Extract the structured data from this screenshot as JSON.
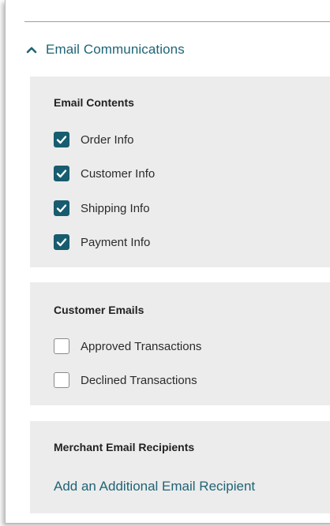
{
  "section": {
    "title": "Email Communications",
    "expanded": true,
    "accent_color": "#1f6475"
  },
  "email_contents": {
    "title": "Email Contents",
    "options": [
      {
        "label": "Order Info",
        "checked": true
      },
      {
        "label": "Customer Info",
        "checked": true
      },
      {
        "label": "Shipping Info",
        "checked": true
      },
      {
        "label": "Payment Info",
        "checked": true
      }
    ]
  },
  "customer_emails": {
    "title": "Customer Emails",
    "options": [
      {
        "label": "Approved Transactions",
        "checked": false
      },
      {
        "label": "Declined Transactions",
        "checked": false
      }
    ]
  },
  "merchant_recipients": {
    "title": "Merchant Email Recipients",
    "add_link": "Add an Additional Email Recipient"
  },
  "icons": {
    "collapse": "chevron-up-icon",
    "checkmark": "checkmark-icon"
  }
}
